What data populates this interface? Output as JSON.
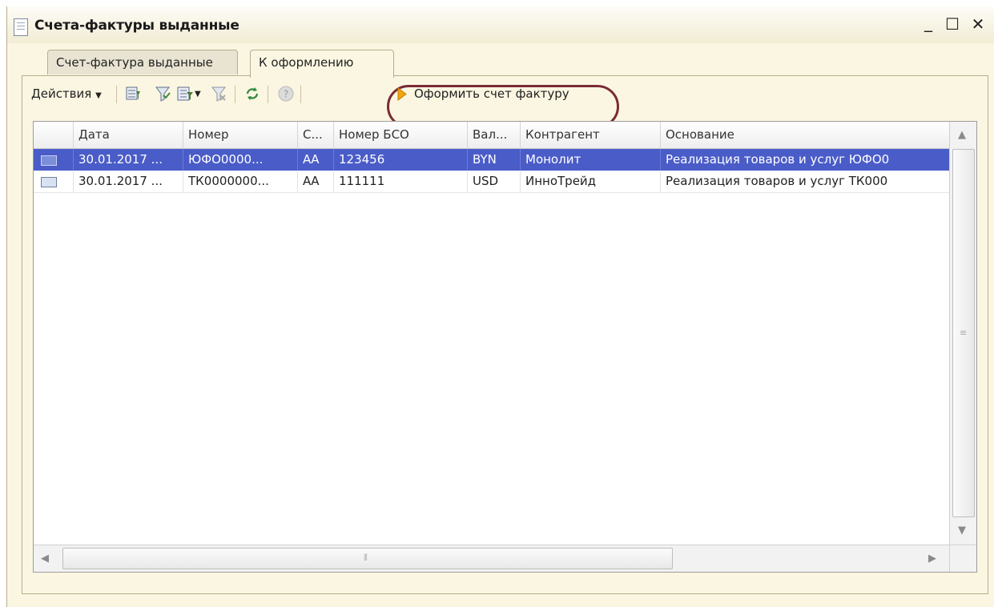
{
  "window": {
    "title": "Счета-фактуры выданные",
    "icon": "document-icon",
    "minimize_label": "_",
    "maximize_label": "☐",
    "close_label": "✕"
  },
  "tabs": [
    {
      "label": "Счет-фактура выданные",
      "active": false
    },
    {
      "label": "К оформлению",
      "active": true
    }
  ],
  "toolbar": {
    "actions_label": "Действия",
    "icons": [
      "filter-settings-icon",
      "filter-by-value-icon",
      "filter-list-icon",
      "filter-clear-icon",
      "refresh-icon",
      "help-icon"
    ],
    "create_invoice_label": "Оформить счет фактуру",
    "highlight_color": "#7a2b35"
  },
  "table": {
    "columns": [
      "",
      "Дата",
      "Номер",
      "С...",
      "Номер БСО",
      "Вал...",
      "Контрагент",
      "Основание"
    ],
    "rows": [
      {
        "selected": true,
        "cells": [
          "30.01.2017 ...",
          "ЮФО0000...",
          "АА",
          "123456",
          "BYN",
          "Монолит",
          "Реализация товаров и услуг ЮФО0"
        ]
      },
      {
        "selected": false,
        "cells": [
          "30.01.2017 ...",
          "ТК0000000...",
          "АА",
          "111111",
          "USD",
          "ИнноТрейд",
          "Реализация товаров и услуг ТК000"
        ]
      }
    ],
    "selection_color": "#4a5cc8"
  }
}
